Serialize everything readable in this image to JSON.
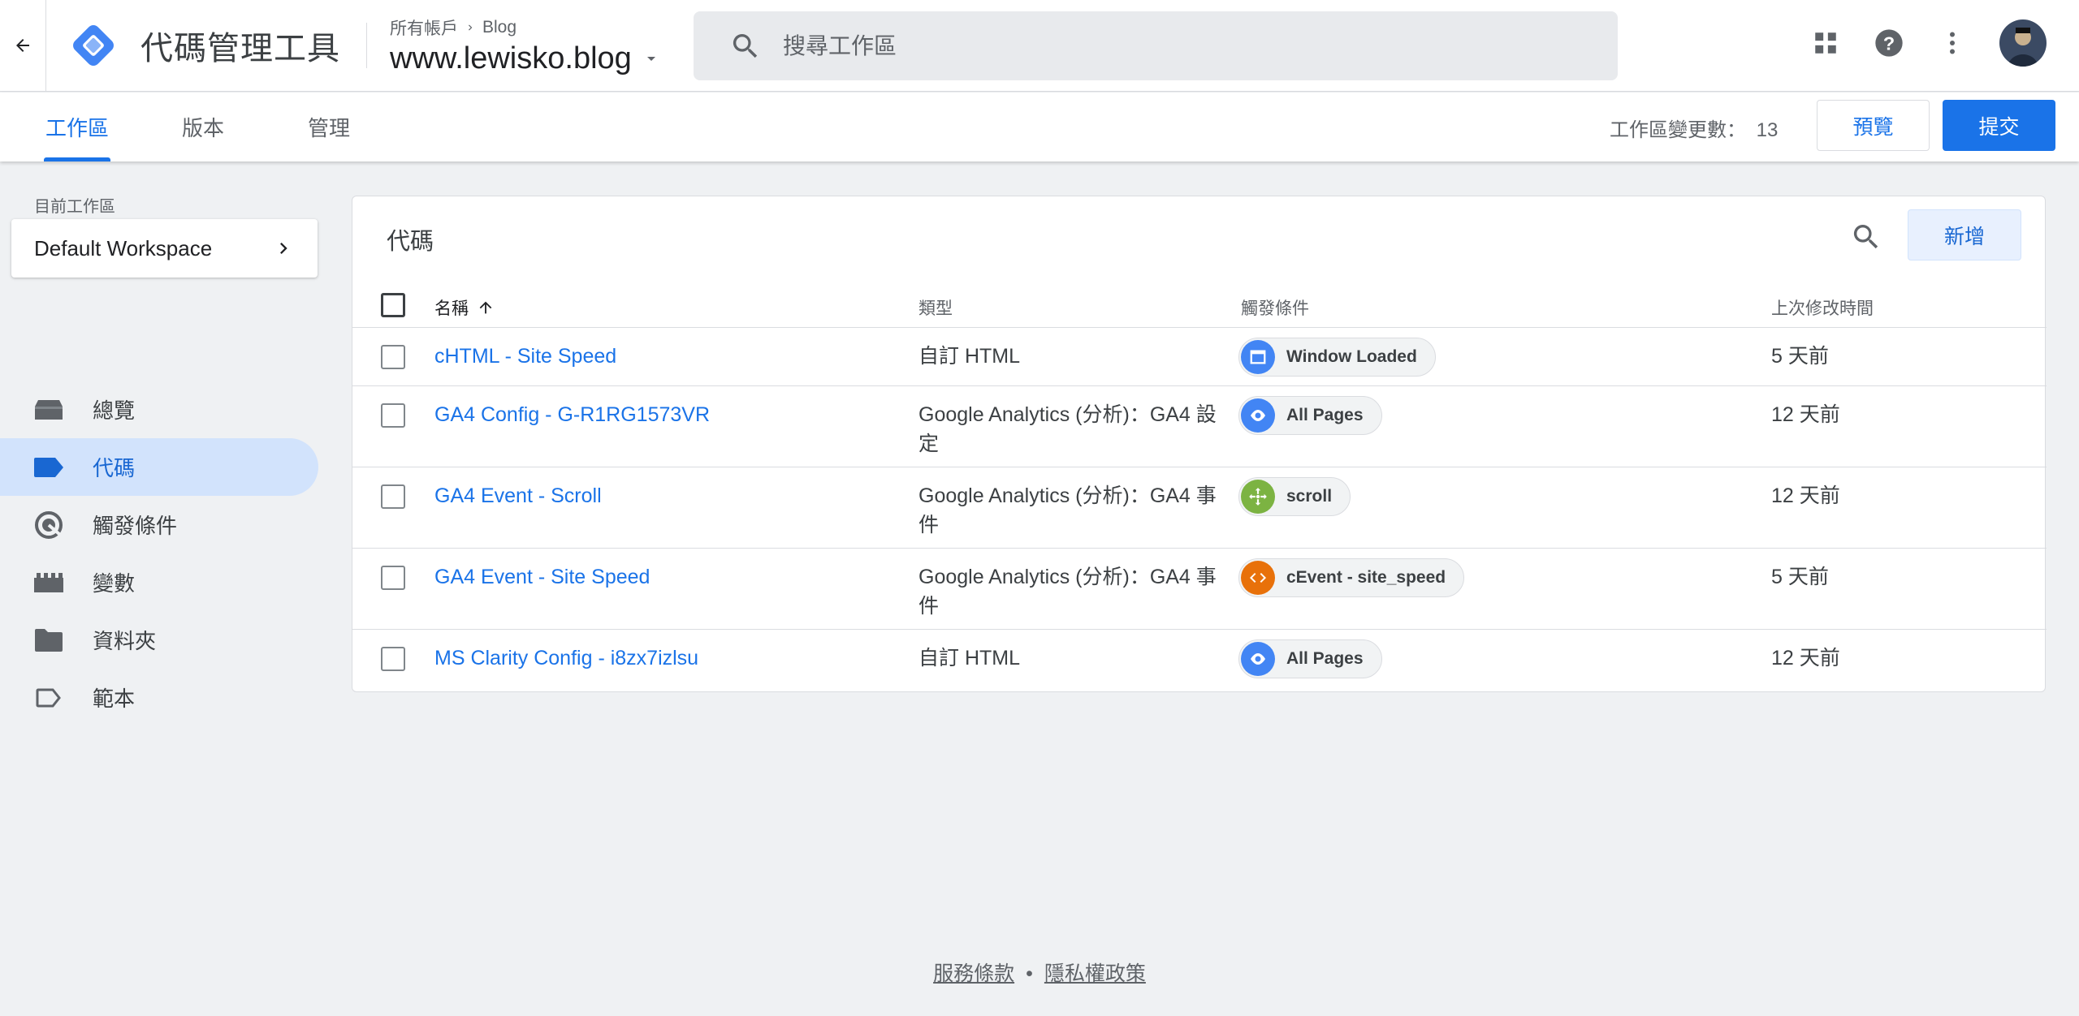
{
  "header": {
    "product_name": "代碼管理工具",
    "breadcrumb_account": "所有帳戶",
    "breadcrumb_container": "Blog",
    "container_name": "www.lewisko.blog",
    "search_placeholder": "搜尋工作區"
  },
  "tabs": [
    {
      "label": "工作區",
      "active": true
    },
    {
      "label": "版本",
      "active": false
    },
    {
      "label": "管理",
      "active": false
    }
  ],
  "workspace_changes_label": "工作區變更數：",
  "workspace_changes_count": "13",
  "preview_label": "預覽",
  "submit_label": "提交",
  "sidebar": {
    "current_workspace_label": "目前工作區",
    "workspace_name": "Default Workspace",
    "items": [
      {
        "label": "總覽",
        "icon": "overview-icon"
      },
      {
        "label": "代碼",
        "icon": "tag-icon",
        "active": true
      },
      {
        "label": "觸發條件",
        "icon": "trigger-icon"
      },
      {
        "label": "變數",
        "icon": "variable-icon"
      },
      {
        "label": "資料夾",
        "icon": "folder-icon"
      },
      {
        "label": "範本",
        "icon": "template-icon"
      }
    ]
  },
  "tags_panel": {
    "title": "代碼",
    "new_label": "新增",
    "columns": {
      "name": "名稱",
      "type": "類型",
      "trigger": "觸發條件",
      "modified": "上次修改時間"
    },
    "rows": [
      {
        "name": "cHTML - Site Speed",
        "type": "自訂 HTML",
        "trigger": "Window Loaded",
        "trigger_icon": "window-icon",
        "trigger_color": "#4285f4",
        "modified": "5 天前"
      },
      {
        "name": "GA4 Config - G-R1RG1573VR",
        "type": "Google Analytics (分析)：GA4 設定",
        "trigger": "All Pages",
        "trigger_icon": "eye-icon",
        "trigger_color": "#4285f4",
        "modified": "12 天前"
      },
      {
        "name": "GA4 Event - Scroll",
        "type": "Google Analytics (分析)：GA4 事件",
        "trigger": "scroll",
        "trigger_icon": "move-icon",
        "trigger_color": "#7cb342",
        "modified": "12 天前"
      },
      {
        "name": "GA4 Event - Site Speed",
        "type": "Google Analytics (分析)：GA4 事件",
        "trigger": "cEvent - site_speed",
        "trigger_icon": "code-icon",
        "trigger_color": "#e8710a",
        "modified": "5 天前"
      },
      {
        "name": "MS Clarity Config - i8zx7izlsu",
        "type": "自訂 HTML",
        "trigger": "All Pages",
        "trigger_icon": "eye-icon",
        "trigger_color": "#4285f4",
        "modified": "12 天前"
      }
    ]
  },
  "footer": {
    "terms": "服務條款",
    "separator": "•",
    "privacy": "隱私權政策"
  },
  "colors": {
    "accent": "#1a73e8",
    "nav_active_bg": "#d2e3fc",
    "page_bg": "#eff1f3"
  }
}
